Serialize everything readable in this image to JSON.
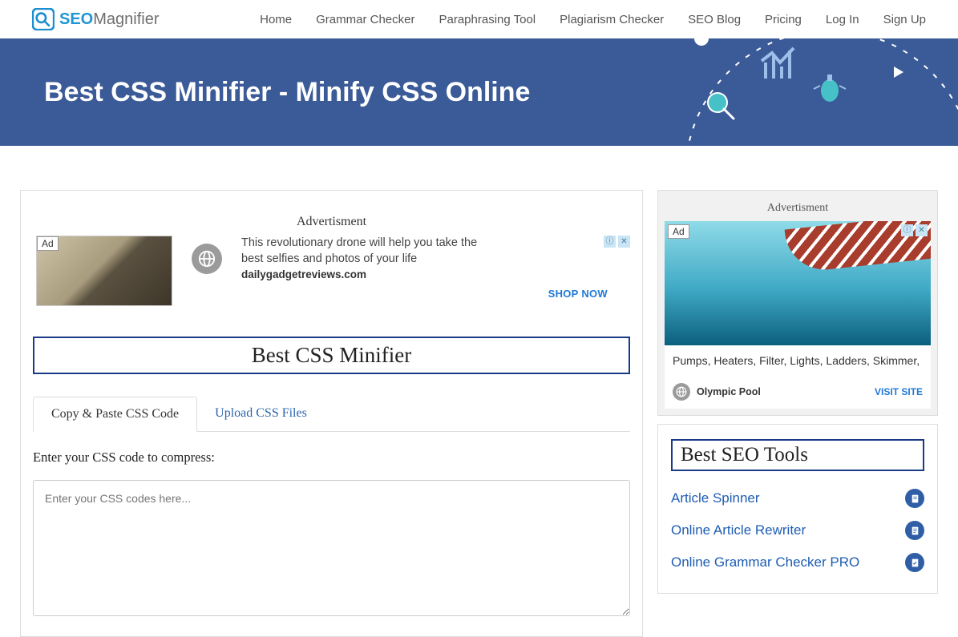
{
  "brand": {
    "part1": "SEO",
    "part2": "Magnifier"
  },
  "nav": {
    "home": "Home",
    "grammar": "Grammar Checker",
    "paraphrase": "Paraphrasing Tool",
    "plagiarism": "Plagiarism Checker",
    "blog": "SEO Blog",
    "pricing": "Pricing",
    "login": "Log In",
    "signup": "Sign Up"
  },
  "hero": {
    "title": "Best CSS Minifier - Minify CSS Online"
  },
  "main_ad": {
    "label": "Advertisment",
    "tag": "Ad",
    "text": "This revolutionary drone will help you take the best selfies and photos of your life",
    "domain": "dailygadgetreviews.com",
    "cta": "SHOP NOW"
  },
  "tool": {
    "heading": "Best CSS Minifier",
    "tab1": "Copy & Paste CSS Code",
    "tab2": "Upload CSS Files",
    "field_label": "Enter your CSS code to compress:",
    "placeholder": "Enter your CSS codes here..."
  },
  "side_ad": {
    "label": "Advertisment",
    "tag": "Ad",
    "caption": "Pumps, Heaters, Filter, Lights, Ladders, Skimmer,",
    "name": "Olympic Pool",
    "visit": "VISIT SITE"
  },
  "tools": {
    "heading": "Best SEO Tools",
    "items": [
      "Article Spinner",
      "Online Article Rewriter",
      "Online Grammar Checker PRO"
    ]
  }
}
